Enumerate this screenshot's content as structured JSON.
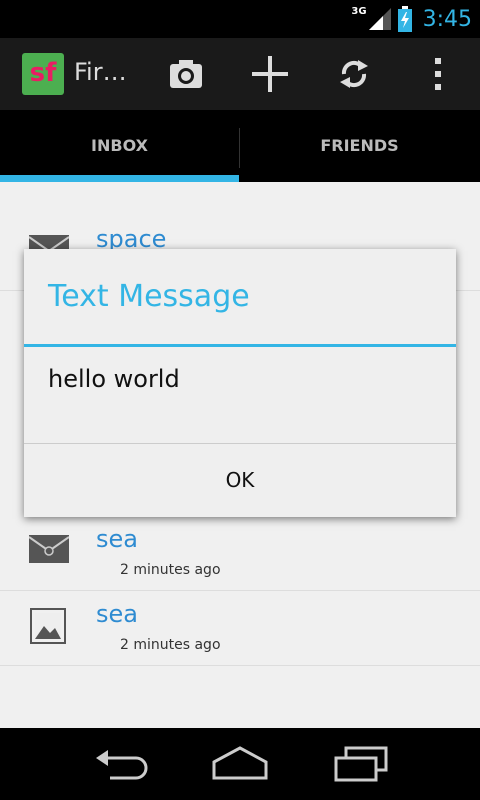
{
  "status": {
    "network": "3G",
    "time": "3:45"
  },
  "actionbar": {
    "app_icon_text": "sf",
    "title": "Fir…",
    "icons": [
      "camera-icon",
      "add-icon",
      "refresh-icon",
      "overflow-icon"
    ]
  },
  "tabs": [
    {
      "label": "INBOX",
      "selected": true
    },
    {
      "label": "FRIENDS",
      "selected": false
    }
  ],
  "list": [
    {
      "title": "space",
      "time": "",
      "icon": "mail-icon"
    },
    {
      "title": "sea",
      "time": "2 minutes ago",
      "icon": "mail-icon"
    },
    {
      "title": "sea",
      "time": "2 minutes ago",
      "icon": "image-icon"
    }
  ],
  "dialog": {
    "title": "Text Message",
    "message": "hello world",
    "ok_label": "OK"
  },
  "colors": {
    "accent": "#33b5e5",
    "link": "#2e8bd1"
  },
  "navbar": {
    "icons": [
      "back-icon",
      "home-icon",
      "recents-icon"
    ]
  }
}
